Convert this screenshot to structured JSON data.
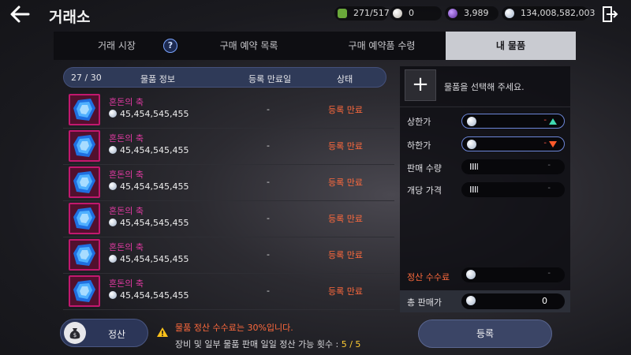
{
  "header": {
    "title": "거래소",
    "resources": [
      {
        "icon": "green-energy-icon",
        "value": "271/517",
        "color": "#7bb84a"
      },
      {
        "icon": "pearl-icon",
        "value": "0",
        "color": "#d8d4cc"
      },
      {
        "icon": "purple-crystal-icon",
        "value": "3,989",
        "color": "#8a4fd0"
      },
      {
        "icon": "silver-coin-icon",
        "value": "134,008,582,003",
        "color": "#cfd8e6"
      }
    ]
  },
  "tabs": [
    {
      "label": "거래 시장",
      "active": false
    },
    {
      "label": "구매 예약 목록",
      "active": false
    },
    {
      "label": "구매 예약품 수령",
      "active": false
    },
    {
      "label": "내 물품",
      "active": true
    }
  ],
  "list": {
    "count": "27 / 30",
    "columns": [
      "물품 정보",
      "등록 만료일",
      "상태"
    ],
    "items": [
      {
        "name": "혼돈의 축",
        "price": "45,454,545,455",
        "expiry": "-",
        "status": "등록 만료"
      },
      {
        "name": "혼돈의 축",
        "price": "45,454,545,455",
        "expiry": "-",
        "status": "등록 만료"
      },
      {
        "name": "혼돈의 축",
        "price": "45,454,545,455",
        "expiry": "-",
        "status": "등록 만료"
      },
      {
        "name": "혼돈의 축",
        "price": "45,454,545,455",
        "expiry": "-",
        "status": "등록 만료"
      },
      {
        "name": "혼돈의 축",
        "price": "45,454,545,455",
        "expiry": "-",
        "status": "등록 만료"
      },
      {
        "name": "혼돈의 축",
        "price": "45,454,545,455",
        "expiry": "-",
        "status": "등록 만료"
      }
    ]
  },
  "panel": {
    "select_prompt": "물품을 선택해 주세요.",
    "upper_price": {
      "label": "상한가",
      "value": "-"
    },
    "lower_price": {
      "label": "하한가",
      "value": "-"
    },
    "quantity": {
      "label": "판매 수량",
      "value": "-"
    },
    "unit_price": {
      "label": "개당 가격",
      "value": "-"
    },
    "fee": {
      "label": "정산 수수료",
      "value": "-"
    },
    "total": {
      "label": "총 판매가",
      "value": "0"
    },
    "colors": {
      "up": "#3fd9b0",
      "down": "#ff5a2a",
      "warning": "#ff6a3d"
    }
  },
  "footer": {
    "settle_label": "정산",
    "notice_fee": "물품 정산 수수료는 30%입니다.",
    "notice_count_text": "장비 및 일부 물품 판매 일일 정산 가능 횟수 : ",
    "notice_count": "5 / 5",
    "register_label": "등록"
  }
}
